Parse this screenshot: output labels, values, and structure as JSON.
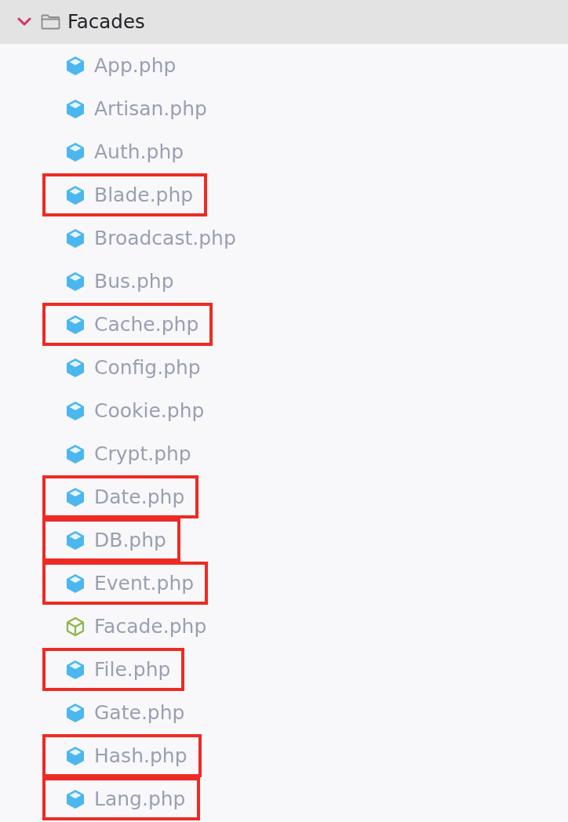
{
  "folder": {
    "name": "Facades",
    "expanded": true
  },
  "items": [
    {
      "name": "App.php",
      "kind": "filled",
      "highlighted": false
    },
    {
      "name": "Artisan.php",
      "kind": "filled",
      "highlighted": false
    },
    {
      "name": "Auth.php",
      "kind": "filled",
      "highlighted": false
    },
    {
      "name": "Blade.php",
      "kind": "filled",
      "highlighted": true
    },
    {
      "name": "Broadcast.php",
      "kind": "filled",
      "highlighted": false
    },
    {
      "name": "Bus.php",
      "kind": "filled",
      "highlighted": false
    },
    {
      "name": "Cache.php",
      "kind": "filled",
      "highlighted": true
    },
    {
      "name": "Config.php",
      "kind": "filled",
      "highlighted": false
    },
    {
      "name": "Cookie.php",
      "kind": "filled",
      "highlighted": false
    },
    {
      "name": "Crypt.php",
      "kind": "filled",
      "highlighted": false
    },
    {
      "name": "Date.php",
      "kind": "filled",
      "highlighted": true
    },
    {
      "name": "DB.php",
      "kind": "filled",
      "highlighted": true
    },
    {
      "name": "Event.php",
      "kind": "filled",
      "highlighted": true
    },
    {
      "name": "Facade.php",
      "kind": "outline",
      "highlighted": false
    },
    {
      "name": "File.php",
      "kind": "filled",
      "highlighted": true
    },
    {
      "name": "Gate.php",
      "kind": "filled",
      "highlighted": false
    },
    {
      "name": "Hash.php",
      "kind": "filled",
      "highlighted": true
    },
    {
      "name": "Lang.php",
      "kind": "filled",
      "highlighted": true
    }
  ]
}
